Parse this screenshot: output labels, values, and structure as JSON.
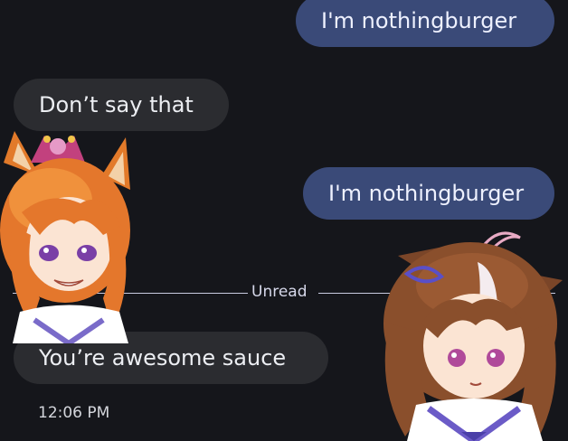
{
  "messages": [
    {
      "text": "I'm nothingburger",
      "direction": "outgoing"
    },
    {
      "text": "Don’t say that",
      "direction": "incoming"
    },
    {
      "text": "I'm nothingburger",
      "direction": "outgoing"
    },
    {
      "text": "You’re awesome sauce",
      "direction": "incoming"
    }
  ],
  "divider": {
    "label": "Unread"
  },
  "timestamp": "12:06 PM",
  "colors": {
    "background": "#15161b",
    "outgoing_bubble": "#3a4a78",
    "incoming_bubble": "#2b2c30"
  },
  "stickers": [
    {
      "icon": "anime-girl-orange-hair-sticker"
    },
    {
      "icon": "anime-girl-brown-hair-sticker"
    }
  ]
}
